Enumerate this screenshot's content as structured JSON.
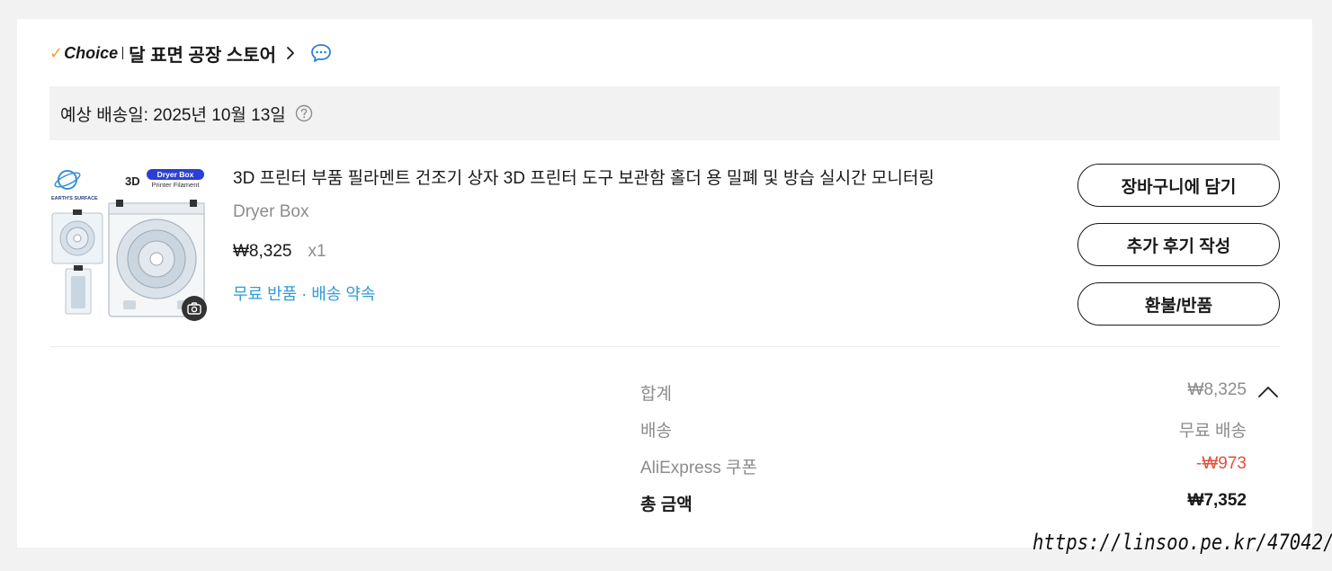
{
  "store": {
    "choice_label": "Choice",
    "name": "달 표면 공장 스토어"
  },
  "delivery": {
    "text": "예상 배송일: 2025년 10월 13일"
  },
  "product": {
    "image_badge_text": "Dryer Box",
    "image_badge_sub": "Printer Filament",
    "image_logo_text": "3D",
    "image_brand_text": "EARTH'S SURFACE",
    "title": "3D 프린터 부품 필라멘트 건조기 상자 3D 프린터 도구 보관함 홀더 용 밀폐 및 방습 실시간 모니터링",
    "variant": "Dryer Box",
    "price": "₩8,325",
    "quantity": "x1",
    "tags": "무료 반품 · 배송 약속"
  },
  "actions": {
    "add_to_cart": "장바구니에 담기",
    "write_review": "추가 후기 작성",
    "refund": "환불/반품"
  },
  "summary": {
    "subtotal_label": "합계",
    "subtotal_value": "₩8,325",
    "shipping_label": "배송",
    "shipping_value": "무료 배송",
    "coupon_label": "AliExpress 쿠폰",
    "coupon_value": "-₩973",
    "total_label": "총 금액",
    "total_value": "₩7,352"
  },
  "watermark": "https://linsoo.pe.kr/47042/",
  "colors": {
    "choice_check": "#f6a01a",
    "link_blue": "#2e9cd4",
    "discount_red": "#e4503c",
    "badge_blue": "#2b3fd6"
  }
}
